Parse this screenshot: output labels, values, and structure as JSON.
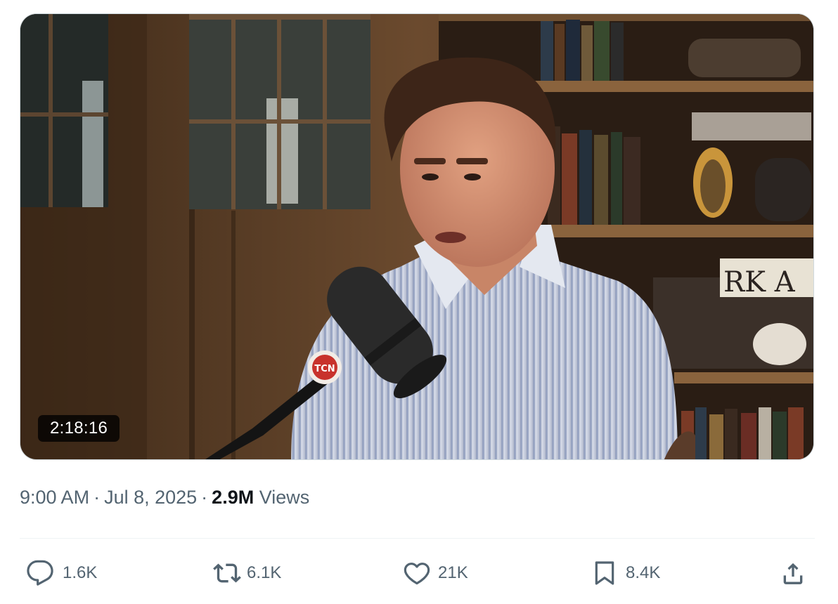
{
  "tweet": {
    "video": {
      "duration": "2:18:16",
      "mic_logo_text": "TCN",
      "shelf_sign_text": "RK A"
    },
    "meta": {
      "time": "9:00 AM",
      "separator": "·",
      "date": "Jul 8, 2025",
      "views_count": "2.9M",
      "views_label": "Views"
    },
    "actions": {
      "replies": {
        "icon": "reply-icon",
        "count": "1.6K"
      },
      "reposts": {
        "icon": "repost-icon",
        "count": "6.1K"
      },
      "likes": {
        "icon": "heart-icon",
        "count": "21K"
      },
      "bookmarks": {
        "icon": "bookmark-icon",
        "count": "8.4K"
      },
      "share": {
        "icon": "share-icon"
      }
    }
  },
  "colors": {
    "secondary_text": "#536471",
    "primary_text": "#0f1419",
    "divider": "#eff3f4"
  }
}
